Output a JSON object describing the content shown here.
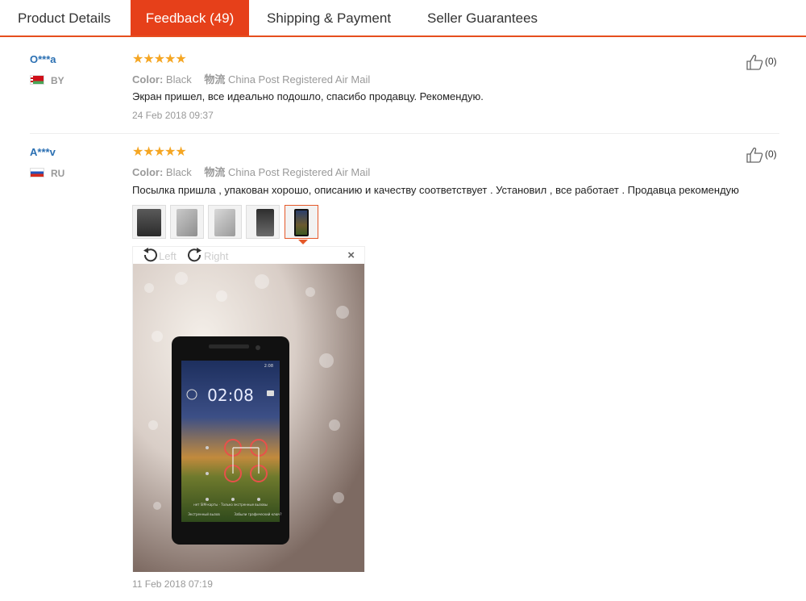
{
  "tabs": [
    {
      "label": "Product Details",
      "active": false
    },
    {
      "label": "Feedback (49)",
      "active": true
    },
    {
      "label": "Shipping & Payment",
      "active": false
    },
    {
      "label": "Seller Guarantees",
      "active": false
    }
  ],
  "reviews": [
    {
      "user": "O***a",
      "country": "BY",
      "stars": "★★★★★",
      "color_label": "Color:",
      "color_value": "Black",
      "shipping_label": "物流",
      "shipping_value": "China Post Registered Air Mail",
      "text": "Экран пришел, все идеально подошло, спасибо продавцу. Рекомендую.",
      "date": "24 Feb 2018 09:37",
      "likes": "(0)"
    },
    {
      "user": "A***v",
      "country": "RU",
      "stars": "★★★★★",
      "color_label": "Color:",
      "color_value": "Black",
      "shipping_label": "物流",
      "shipping_value": "China Post Registered Air Mail",
      "text": "Посылка пришла , упакован хорошо, описанию и качеству соответствует . Установил , все работает . Продавца рекомендую",
      "date": "11 Feb 2018 07:19",
      "likes": "(0)",
      "photo_count": 5,
      "selected_photo": 5
    }
  ],
  "viewer": {
    "rotate_left": "Left",
    "rotate_right": "Right",
    "close": "×",
    "phone_time": "02:08",
    "phone_status_time": "2:08",
    "phone_notice_1": "нет SIM-карты · Только экстренные вызовы",
    "phone_notice_2": "Экстренный вызов",
    "phone_notice_3": "Забыли графический ключ?"
  },
  "colors": {
    "accent": "#e6401a",
    "user_link": "#2a6fb2",
    "star": "#f5a623"
  }
}
